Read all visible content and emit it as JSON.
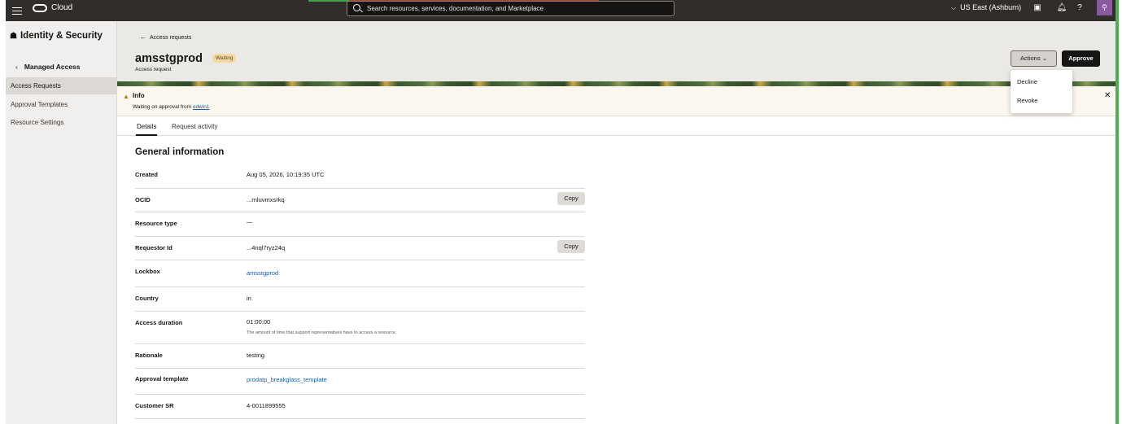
{
  "topbar": {
    "cloud_label": "Cloud",
    "search_placeholder": "Search resources, services, documentation, and Marketplace",
    "region": "US East (Ashburn)"
  },
  "sidebar": {
    "title": "Identity & Security",
    "back_label": "Managed Access",
    "items": [
      {
        "label": "Access Requests",
        "active": true
      },
      {
        "label": "Approval Templates",
        "active": false
      },
      {
        "label": "Resource Settings",
        "active": false
      }
    ]
  },
  "header": {
    "back_link": "Access requests",
    "title": "amsstgprod",
    "status": "Waiting",
    "subtitle": "Access request",
    "actions_label": "Actions",
    "approve_label": "Approve"
  },
  "actions_menu": [
    "Decline",
    "Revoke"
  ],
  "info": {
    "title": "Info",
    "text_prefix": "Waiting on approval from ",
    "approver": "edwin1"
  },
  "tabs": [
    "Details",
    "Request activity"
  ],
  "general": {
    "title": "General information",
    "copy_label": "Copy",
    "rows": [
      {
        "label": "Created",
        "value": "Aug 05, 2026, 10:19:35 UTC"
      },
      {
        "label": "OCID",
        "value": "...rnluvmxsrkq"
      },
      {
        "label": "Resource type",
        "value": "—"
      },
      {
        "label": "Requestor Id",
        "value": "...4nql7ryz24q"
      },
      {
        "label": "Lockbox",
        "value": "amsstgprod"
      },
      {
        "label": "Country",
        "value": "in"
      },
      {
        "label": "Access duration",
        "value": "01:00:00",
        "help": "The amount of time that support representatives have to access a resource."
      },
      {
        "label": "Rationale",
        "value": "testing"
      },
      {
        "label": "Approval template",
        "value": "prodatp_breakglass_template"
      },
      {
        "label": "Customer SR",
        "value": "4-0011899555"
      }
    ]
  }
}
